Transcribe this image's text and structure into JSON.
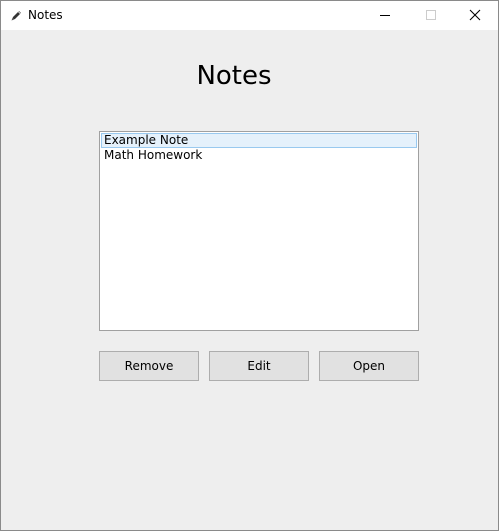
{
  "window": {
    "title": "Notes",
    "app_icon": "pencil-icon",
    "controls": [
      "minimize-icon",
      "maximize-icon",
      "close-icon"
    ]
  },
  "main": {
    "heading": "Notes"
  },
  "notes_list": {
    "items": [
      {
        "label": "Example Note",
        "selected": true
      },
      {
        "label": "Math Homework",
        "selected": false
      }
    ]
  },
  "buttons": {
    "remove_label": "Remove",
    "edit_label": "Edit",
    "open_label": "Open"
  },
  "colors": {
    "background": "#eeeeee",
    "selection_fill": "#e5f1fb",
    "selection_border": "#99c9ef",
    "button_fill": "#e1e1e1"
  }
}
